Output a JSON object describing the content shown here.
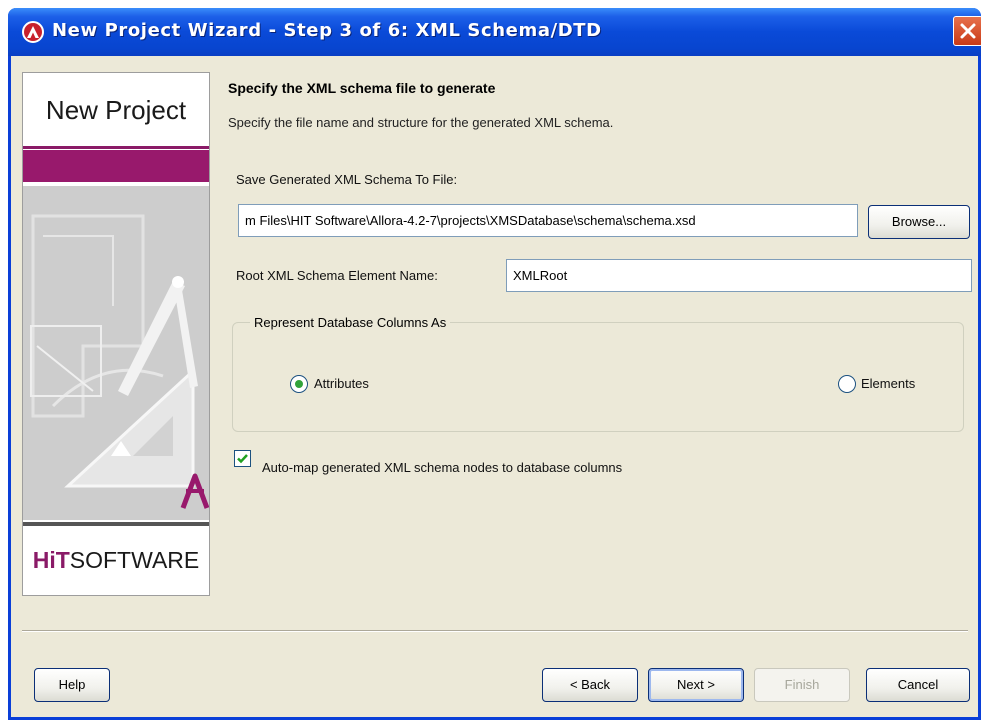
{
  "window": {
    "title": "New Project Wizard - Step 3 of 6: XML Schema/DTD"
  },
  "left_panel": {
    "title": "New Project",
    "logo_bold": "HiT",
    "logo_rest": "SOFTWARE"
  },
  "header": {
    "heading": "Specify the XML schema file to generate",
    "subheading": "Specify the file name and structure for the generated XML schema."
  },
  "save_file": {
    "label": "Save Generated XML Schema To File:",
    "value": "m Files\\HIT Software\\Allora-4.2-7\\projects\\XMSDatabase\\schema\\schema.xsd",
    "browse_label": "Browse..."
  },
  "root_element": {
    "label": "Root XML Schema Element Name:",
    "value": "XMLRoot"
  },
  "columns_group": {
    "label": "Represent Database Columns As",
    "options": [
      {
        "label": "Attributes",
        "selected": true
      },
      {
        "label": "Elements",
        "selected": false
      }
    ]
  },
  "automap": {
    "label": "Auto-map generated XML schema nodes to database columns",
    "checked": true
  },
  "footer": {
    "help": "Help",
    "back": "< Back",
    "next": "Next >",
    "finish": "Finish",
    "cancel": "Cancel"
  },
  "colors": {
    "titlebar": "#0a4ad8",
    "brand_magenta": "#98196c",
    "dialog_bg": "#ece9d8"
  }
}
